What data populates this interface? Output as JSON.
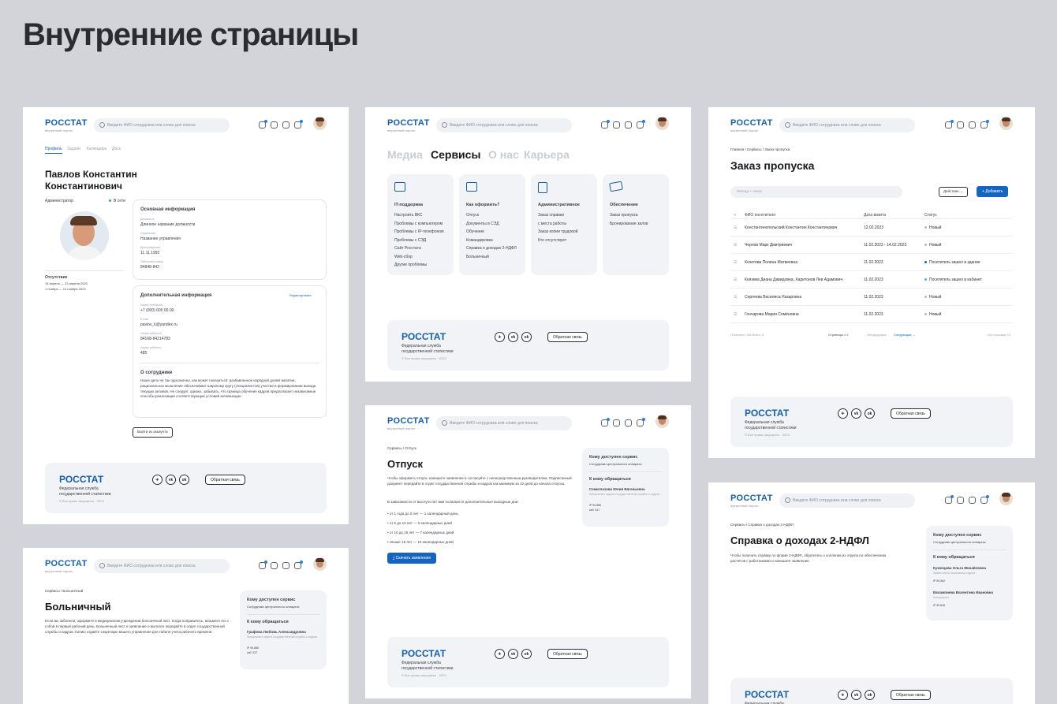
{
  "page_title": "Внутренние страницы",
  "brand": {
    "logo": "РОССТАТ",
    "tagline": "внутренний портал",
    "footer_sub": "Федеральная служба\nгосударственной статистики",
    "copyright": "© Все права защищены · 2023"
  },
  "search_placeholder": "Введите ФИО сотрудника или слово для поиска",
  "footer": {
    "feedback": "Обратная связь",
    "soc": [
      "✈",
      "vk",
      "ok"
    ]
  },
  "profile": {
    "tabs": [
      "Профиль",
      "Задачи",
      "Календарь",
      "Доск"
    ],
    "name1": "Павлов Константин",
    "name2": "Константинович",
    "role": "Администратор",
    "status": "В сети",
    "absence_title": "Отсутствие",
    "absence1": "16 апреля — 23 апреля 2023",
    "absence2": "1 ноября — 14 ноября 2023",
    "main_title": "Основная информация",
    "fields": [
      [
        "Должность",
        "Длинное название должности"
      ],
      [
        "Управление",
        "Название управления"
      ],
      [
        "Дата рождения",
        "11.11.1992"
      ],
      [
        "Табельный номер",
        "84848-842"
      ]
    ],
    "extra_title": "Дополнительная информация",
    "edit": "Редактировать",
    "extra": [
      [
        "Номер телефона",
        "+7 (000) 000 00 00"
      ],
      [
        "E-mail",
        "pavlov_k@yandex.ru"
      ],
      [
        "Номер кабинета",
        "84168-84214783"
      ],
      [
        "Номер рабочего",
        "485"
      ]
    ],
    "about_title": "О сотруднике",
    "about": "Наше дело не так однозначно, как может показаться: разбавленное изрядной долей эмпатии, рациональное мышление обеспечивает широкому кругу (специалистов) участие в формировании вывода текущих активов. Не следует, однако, забывать, что граница обучения кадров предполагает независимые способы реализации соответствующих условий активизации",
    "logout": "Выйти из аккаунта"
  },
  "services": {
    "tabs": [
      "Медиа",
      "Сервисы",
      "О нас",
      "Карьера"
    ],
    "cols": [
      {
        "title": "IT-поддержка",
        "items": [
          "Настроить ВКС",
          "Проблемы с компьютером",
          "Проблемы с IP-телефоном",
          "Проблемы с СЭД",
          "Сайт Росстата",
          "Web-сбор",
          "Другие проблемы"
        ]
      },
      {
        "title": "Как оформить?",
        "items": [
          "Отпуск",
          "Документы в СЭД",
          "Обучение",
          "Командировка",
          "Справка о доходах 2-НДФЛ",
          "Больничный"
        ]
      },
      {
        "title": "Административное",
        "items": [
          "Заказ справки",
          "с места работы",
          "Заказ копии трудовой",
          "Кто отсутствует"
        ]
      },
      {
        "title": "Обеспечение",
        "items": [
          "Заказ пропуска",
          "Бронирование залов"
        ]
      }
    ]
  },
  "pass": {
    "crumbs": "Главная  /  Сервисы  /  Заказ пропуска",
    "title": "Заказ пропуска",
    "filter": "Фильтр + поиск",
    "action": "Действие",
    "add": "+ Добавить",
    "cols": [
      "ФИО посетителя",
      "Дата визита",
      "Статус"
    ],
    "rows": [
      [
        "Константинопольский Константин Константинович",
        "12.02.2023",
        "Новый"
      ],
      [
        "Чернов Марк Дмитриевич",
        "11.02.2023 - 14.02.2023",
        "Новый"
      ],
      [
        "Кочетова Полина Матвеевна",
        "11.02.2023",
        "Посетитель зашел в здание"
      ],
      [
        "Князева Диана Давидовна, Харитонов Лев Адамович",
        "11.02.2023",
        "Посетитель зашел в кабинет"
      ],
      [
        "Сергеева Василиса Назаровна",
        "11.02.2023",
        "Новый"
      ],
      [
        "Гончарова Мария Семёновна",
        "11.02.2023",
        "Новый"
      ]
    ],
    "pager_left": "Отмечено: 0/6    Всего: 6",
    "pages": "Страницы  1  2",
    "prev": "← Предыдущая",
    "next": "Следующая →",
    "per_page": "На странице  10"
  },
  "sick": {
    "crumbs": "Сервисы  /  Больничный",
    "title": "Больничный",
    "text": "Если вы заболели, оформите в медицинском учреждении больничный лист. Когда поправитесь, возьмите его с собой в первый рабочий день. Больничный лист и заявление о выплате передайте в отдел государственной службы и кадров. Копию отдайте секретарю вашего управления для табеля учета рабочего времени.",
    "side": {
      "who": "Кому доступен сервис",
      "who_v": "Сотрудники центрального аппарата",
      "to": "К кому обращаться",
      "p1": "Графова Любовь Александровна",
      "p1r": "Консультант отдела государственной службы и кадров",
      "p1t": "IP 99-886",
      "p1k": "каб. 817"
    }
  },
  "vac": {
    "crumbs": "Сервисы  /  Отпуск",
    "title": "Отпуск",
    "p1": "Чтобы оформить отпуск, напишите заявление и согласуйте с непосредственным руководителем. Подписанный документ передайте в отдел государственной службы и кадров как минимум за 10 дней до начала отпуска.",
    "p2": "В зависимости от выслуги лет вам полагаются дополнительные выходные дни:",
    "list": [
      "• от 1 года до 5 лет — 1 календарный день",
      "• от 5 до 10 лет — 5 календарных дней",
      "• от 10 до 15 лет — 7 календарных дней",
      "• свыше 15 лет — 10 календарных дней"
    ],
    "btn": "⤓ Скачать заявление",
    "side": {
      "who": "Кому доступен сервис",
      "who_v": "Сотрудники центрального аппарата",
      "to": "К кому обращаться",
      "p1": "Семиглазова Юлия Евгеньевна",
      "p1r": "Консультант отдела государственной службы и кадров",
      "p1t": "IP 99-886",
      "p1k": "каб. 817"
    }
  },
  "ndfl": {
    "crumbs": "Сервисы  /  Справка о доходах 2-НДФЛ",
    "title": "Справка о доходах 2-НДФЛ",
    "text": "Чтобы получить справку по форме 2-НДФЛ, обратитесь к коллегам из отдела по обеспечению расчётов с работниками и напишите заявление.",
    "side": {
      "who": "Кому доступен сервис",
      "who_v": "Сотрудники центрального аппарата",
      "to": "К кому обращаться",
      "p1": "Кузнецова Ольга Михайловна",
      "p1r": "Заместитель начальника отдела",
      "p1t": "IP 99-562",
      "p2": "Евлампиева Валентина Ивановна",
      "p2r": "Консультант",
      "p2t": "IP 99-546"
    }
  }
}
